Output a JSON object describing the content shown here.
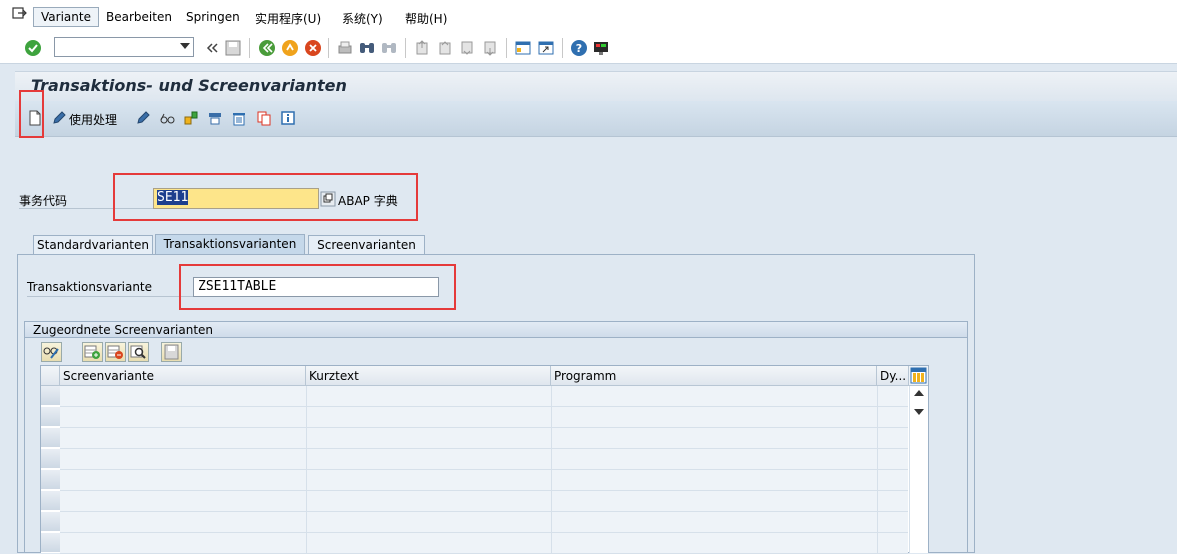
{
  "menu": {
    "items": [
      "Variante",
      "Bearbeiten",
      "Springen",
      "实用程序(U)",
      "系统(Y)",
      "帮助(H)"
    ]
  },
  "toolbar": {
    "command_field_value": "",
    "icons": [
      "enter-icon",
      "back-arrow-icon",
      "save-icon",
      "back-icon",
      "exit-icon",
      "cancel-icon",
      "print-icon",
      "find-icon",
      "find-next-icon",
      "first-page-icon",
      "previous-page-icon",
      "next-page-icon",
      "last-page-icon",
      "create-session-icon",
      "shortcut-icon",
      "help-icon",
      "customize-layout-icon"
    ]
  },
  "title": "Transaktions- und Screenvarianten",
  "app_toolbar": {
    "use_handling_label": "使用处理",
    "icons": [
      "new-document-icon",
      "pencil-icon",
      "edit-pencil-icon",
      "glasses-icon",
      "copy-object-icon",
      "rename-icon",
      "delete-icon",
      "copy-icon",
      "info-icon"
    ]
  },
  "form": {
    "tcode_label": "事务代码",
    "tcode_value": "SE11",
    "tcode_description": "ABAP 字典"
  },
  "tabs": [
    {
      "label": "Standardvarianten",
      "active": false
    },
    {
      "label": "Transaktionsvarianten",
      "active": true
    },
    {
      "label": "Screenvarianten",
      "active": false
    }
  ],
  "transaction_variant": {
    "label": "Transaktionsvariante",
    "value": "ZSE11TABLE"
  },
  "group": {
    "title": "Zugeordnete Screenvarianten"
  },
  "table": {
    "columns": [
      "Screenvariante",
      "Kurztext",
      "Programm",
      "Dy..."
    ],
    "rows": [
      [
        "",
        "",
        "",
        ""
      ],
      [
        "",
        "",
        "",
        ""
      ],
      [
        "",
        "",
        "",
        ""
      ],
      [
        "",
        "",
        "",
        ""
      ],
      [
        "",
        "",
        "",
        ""
      ],
      [
        "",
        "",
        "",
        ""
      ],
      [
        "",
        "",
        "",
        ""
      ],
      [
        "",
        "",
        "",
        ""
      ]
    ]
  },
  "colors": {
    "background": "#dfe8f1",
    "highlight_box": "#e53a3a",
    "input_active": "#fde58a"
  }
}
